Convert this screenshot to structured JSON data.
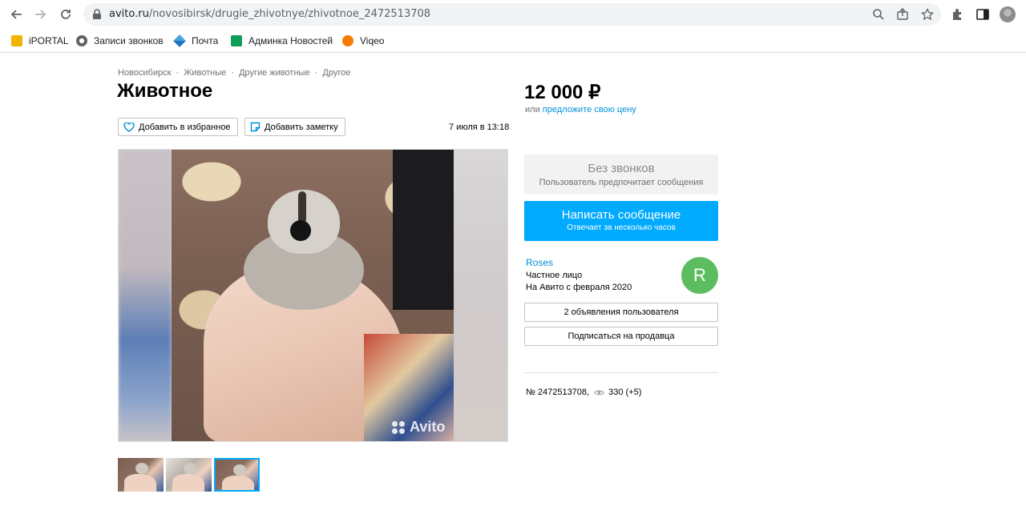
{
  "browser": {
    "url_domain": "avito.ru",
    "url_path": "/novosibirsk/drugie_zhivotnye/zhivotnoe_2472513708"
  },
  "bookmarks": [
    {
      "label": "iPORTAL"
    },
    {
      "label": "Записи звонков"
    },
    {
      "label": "Почта"
    },
    {
      "label": "Админка Новостей"
    },
    {
      "label": "Viqeo"
    }
  ],
  "listing": {
    "breadcrumb": [
      "Новосибирск",
      "Животные",
      "Другие животные",
      "Другое"
    ],
    "breadcrumb_sep": "·",
    "title": "Животное",
    "favorite_label": "Добавить в избранное",
    "note_label": "Добавить заметку",
    "date": "7 июля в 13:18",
    "watermark": "Avito"
  },
  "sidebar": {
    "price": "12 000 ₽",
    "offer_prefix": "или",
    "offer_link": "предложите свою цену",
    "no_calls_title": "Без звонков",
    "no_calls_sub": "Пользователь предпочитает сообщения",
    "write_title": "Написать сообщение",
    "write_sub": "Отвечает за несколько часов",
    "seller_name": "Roses",
    "seller_type": "Частное лицо",
    "seller_since": "На Авито с февраля 2020",
    "seller_initial": "R",
    "ads_label": "2 объявления пользователя",
    "subscribe_label": "Подписаться на продавца",
    "ad_number": "№ 2472513708,",
    "views": "330 (+5)"
  },
  "colors": {
    "accent": "#00aaff",
    "link": "#0091d9",
    "avatar": "#5cbd5f"
  }
}
